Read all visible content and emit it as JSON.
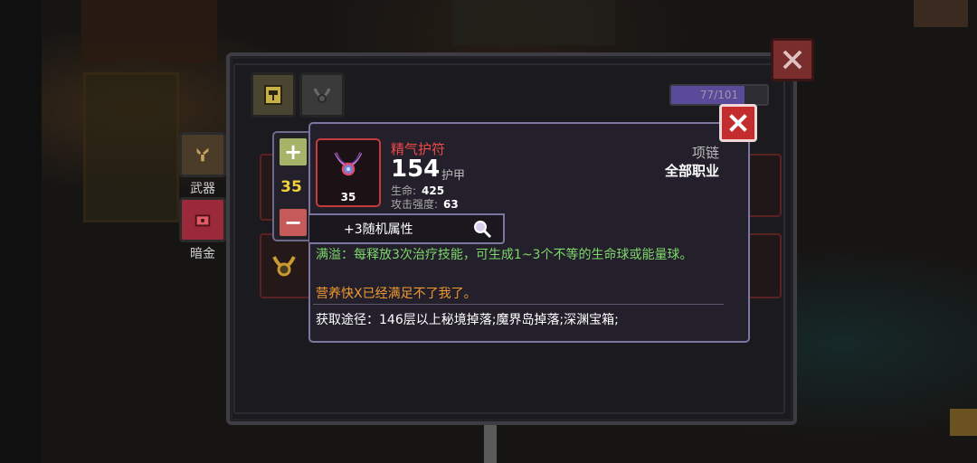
{
  "inventory": {
    "capacity_text": "77/101",
    "capacity_fraction": 0.76,
    "close_icon": "close-icon",
    "tabs": [
      {
        "label": "武器",
        "icon": "sword-icon"
      },
      {
        "label": "暗金",
        "icon": "chest-icon"
      }
    ]
  },
  "stepper": {
    "plus": "+",
    "minus": "−",
    "value": "35"
  },
  "item": {
    "name": "精气护符",
    "level": "35",
    "armor_value": "154",
    "armor_label": "护甲",
    "stats": [
      {
        "label": "生命:",
        "value": "425"
      },
      {
        "label": "攻击强度:",
        "value": "63"
      }
    ],
    "type": "项链",
    "class": "全部职业",
    "random_attr": "+3随机属性",
    "effect": "满溢：每释放3次治疗技能，可生成1~3个不等的生命球或能量球。",
    "flavor": "营养快X已经满足不了我了。",
    "source": "获取途径：146层以上秘境掉落;魔界岛掉落;深渊宝箱;",
    "colors": {
      "name": "#ee4a4a",
      "effect": "#7ed86a",
      "flavor": "#f09a30"
    }
  }
}
